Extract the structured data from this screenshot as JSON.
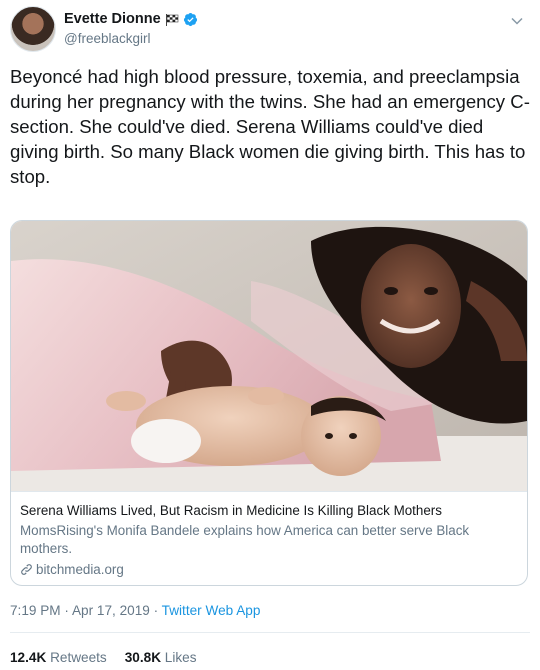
{
  "tweet": {
    "author": {
      "name": "Evette Dionne",
      "handle": "@freeblackgirl"
    },
    "text": "Beyoncé had high blood pressure, toxemia, and preeclampsia during her pregnancy with the twins. She had an emergency C-section. She could've died. Serena Williams could've died giving birth. So many Black women die giving birth. This has to stop.",
    "card": {
      "title": "Serena Williams Lived, But Racism in Medicine Is Killing Black Mothers",
      "description": "MomsRising's Monifa Bandele explains how America can better serve Black mothers.",
      "domain": "bitchmedia.org"
    },
    "meta": {
      "time": "7:19 PM",
      "separator1": " · ",
      "date": "Apr 17, 2019",
      "separator2": " · ",
      "source": "Twitter Web App"
    },
    "stats": {
      "retweets_count": "12.4K",
      "retweets_label": "Retweets",
      "likes_count": "30.8K",
      "likes_label": "Likes"
    }
  },
  "colors": {
    "link_blue": "#1b95e0",
    "secondary_text": "#657786",
    "primary_text": "#14171a",
    "verified_blue": "#1da1f2"
  },
  "icons": [
    "checkered-flag-icon",
    "verified-badge-icon",
    "chevron-down-icon",
    "link-icon"
  ]
}
